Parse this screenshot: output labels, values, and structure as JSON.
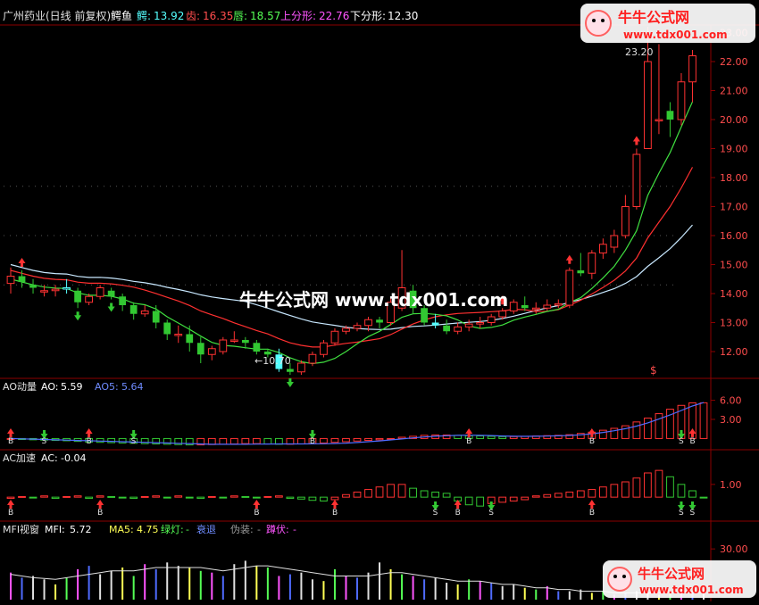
{
  "colors": {
    "background": "#000000",
    "frame": "#8b0000",
    "up": "#ff3232",
    "down": "#32c832",
    "flat_white": "#ffffff",
    "cyan": "#55ffff",
    "ma_white": "#c8e8ff",
    "ma_red": "#ff3030",
    "ma_green": "#40e040",
    "ao5_line": "#4f6bff",
    "ao_text": "#ffffff",
    "label_red": "#ff4d4d",
    "label_green": "#55ff55",
    "label_magenta": "#ff55ff",
    "label_yellow": "#ffff55",
    "label_white": "#e0e0e0",
    "label_blue": "#6f8cff",
    "axis_text": "#ff4d4d"
  },
  "header": {
    "stock": "广州药业(日线 前复权)",
    "alligator": "鳄鱼",
    "jaw_label": "鳄:",
    "jaw_value": "13.92",
    "teeth_label": "齿:",
    "teeth_value": "16.35",
    "lips_label": "唇:",
    "lips_value": "18.57",
    "up_fractal_label": "上分形:",
    "up_fractal_value": "22.76",
    "down_fractal_label": "下分形:",
    "down_fractal_value": "12.30"
  },
  "ao_panel": {
    "name": "AO动量",
    "ao_label": "AO:",
    "ao_value": "5.59",
    "ao5_label": "AO5:",
    "ao5_value": "5.64"
  },
  "ac_panel": {
    "name": "AC加速",
    "ac_label": "AC:",
    "ac_value": "-0.04"
  },
  "mfi_panel": {
    "name": "MFI视窗",
    "mfi_label": "MFI:",
    "mfi_value": "5.72",
    "ma5_label": "MA5:",
    "ma5_value": "4.75",
    "green_light_label": "绿灯:",
    "green_light_value": "-",
    "fade_label": "衰退",
    "fake_label": "伪装:",
    "fake_value": "-",
    "squat_label": "蹲伏:",
    "squat_value": "-"
  },
  "watermark": {
    "brand": "牛牛公式网",
    "url": "www.tdx001.com",
    "center": "牛牛公式网 www.tdx001.com"
  },
  "annotations": {
    "low_label": "←10.70",
    "high_label": "23.20",
    "dollar_mark": "$"
  },
  "chart_data": [
    {
      "type": "candlestick",
      "title": "广州药业(日线 前复权)",
      "ylim": [
        11.2,
        23.2
      ],
      "y_ticks": [
        "12.00",
        "13.00",
        "14.00",
        "15.00",
        "16.00",
        "17.00",
        "18.00",
        "19.00",
        "20.00",
        "21.00",
        "22.00",
        "23.00"
      ],
      "candles": [
        {
          "o": 14.35,
          "h": 14.9,
          "l": 14.0,
          "c": 14.6
        },
        {
          "o": 14.6,
          "h": 14.8,
          "l": 14.2,
          "c": 14.4
        },
        {
          "o": 14.3,
          "h": 14.5,
          "l": 14.0,
          "c": 14.2
        },
        {
          "o": 14.1,
          "h": 14.3,
          "l": 13.9,
          "c": 14.1
        },
        {
          "o": 14.1,
          "h": 14.3,
          "l": 13.9,
          "c": 14.15
        },
        {
          "o": 14.2,
          "h": 14.5,
          "l": 14.0,
          "c": 14.2
        },
        {
          "o": 14.1,
          "h": 14.2,
          "l": 13.5,
          "c": 13.7
        },
        {
          "o": 13.7,
          "h": 14.0,
          "l": 13.6,
          "c": 13.9
        },
        {
          "o": 13.9,
          "h": 14.3,
          "l": 13.8,
          "c": 14.2
        },
        {
          "o": 14.1,
          "h": 14.2,
          "l": 13.8,
          "c": 13.9
        },
        {
          "o": 13.9,
          "h": 14.0,
          "l": 13.4,
          "c": 13.6
        },
        {
          "o": 13.6,
          "h": 13.7,
          "l": 13.1,
          "c": 13.3
        },
        {
          "o": 13.3,
          "h": 13.6,
          "l": 13.2,
          "c": 13.4
        },
        {
          "o": 13.4,
          "h": 13.6,
          "l": 12.8,
          "c": 13.0
        },
        {
          "o": 13.0,
          "h": 13.1,
          "l": 12.4,
          "c": 12.6
        },
        {
          "o": 12.6,
          "h": 12.9,
          "l": 12.3,
          "c": 12.6
        },
        {
          "o": 12.6,
          "h": 12.9,
          "l": 12.0,
          "c": 12.3
        },
        {
          "o": 12.3,
          "h": 12.5,
          "l": 11.6,
          "c": 11.9
        },
        {
          "o": 11.9,
          "h": 12.2,
          "l": 11.7,
          "c": 12.1
        },
        {
          "o": 12.0,
          "h": 12.5,
          "l": 11.9,
          "c": 12.4
        },
        {
          "o": 12.4,
          "h": 12.7,
          "l": 12.3,
          "c": 12.4
        },
        {
          "o": 12.4,
          "h": 12.5,
          "l": 12.1,
          "c": 12.3
        },
        {
          "o": 12.3,
          "h": 12.4,
          "l": 11.9,
          "c": 12.0
        },
        {
          "o": 12.0,
          "h": 12.1,
          "l": 11.8,
          "c": 11.9
        },
        {
          "o": 11.9,
          "h": 12.1,
          "l": 11.3,
          "c": 11.4
        },
        {
          "o": 11.4,
          "h": 11.6,
          "l": 11.2,
          "c": 11.3
        },
        {
          "o": 11.3,
          "h": 11.7,
          "l": 11.2,
          "c": 11.6
        },
        {
          "o": 11.6,
          "h": 12.0,
          "l": 11.5,
          "c": 11.9
        },
        {
          "o": 11.9,
          "h": 12.4,
          "l": 11.8,
          "c": 12.3
        },
        {
          "o": 12.3,
          "h": 12.8,
          "l": 12.2,
          "c": 12.7
        },
        {
          "o": 12.7,
          "h": 12.9,
          "l": 12.6,
          "c": 12.8
        },
        {
          "o": 12.8,
          "h": 13.0,
          "l": 12.7,
          "c": 12.9
        },
        {
          "o": 12.9,
          "h": 13.2,
          "l": 12.7,
          "c": 13.1
        },
        {
          "o": 13.1,
          "h": 13.2,
          "l": 12.8,
          "c": 13.0
        },
        {
          "o": 13.0,
          "h": 13.9,
          "l": 12.9,
          "c": 13.7
        },
        {
          "o": 13.5,
          "h": 15.5,
          "l": 13.4,
          "c": 14.2
        },
        {
          "o": 14.1,
          "h": 14.3,
          "l": 13.3,
          "c": 13.5
        },
        {
          "o": 13.5,
          "h": 13.6,
          "l": 12.9,
          "c": 13.0
        },
        {
          "o": 13.0,
          "h": 13.3,
          "l": 12.8,
          "c": 12.9
        },
        {
          "o": 12.9,
          "h": 13.1,
          "l": 12.6,
          "c": 12.7
        },
        {
          "o": 12.7,
          "h": 13.0,
          "l": 12.6,
          "c": 12.85
        },
        {
          "o": 12.85,
          "h": 13.1,
          "l": 12.7,
          "c": 12.95
        },
        {
          "o": 12.95,
          "h": 13.2,
          "l": 12.8,
          "c": 13.0
        },
        {
          "o": 13.0,
          "h": 13.3,
          "l": 12.9,
          "c": 13.2
        },
        {
          "o": 13.2,
          "h": 13.5,
          "l": 13.1,
          "c": 13.4
        },
        {
          "o": 13.4,
          "h": 13.8,
          "l": 13.3,
          "c": 13.7
        },
        {
          "o": 13.6,
          "h": 13.9,
          "l": 13.4,
          "c": 13.5
        },
        {
          "o": 13.5,
          "h": 13.7,
          "l": 13.3,
          "c": 13.5
        },
        {
          "o": 13.5,
          "h": 13.8,
          "l": 13.4,
          "c": 13.6
        },
        {
          "o": 13.6,
          "h": 13.8,
          "l": 13.5,
          "c": 13.65
        },
        {
          "o": 13.6,
          "h": 14.9,
          "l": 13.5,
          "c": 14.8
        },
        {
          "o": 14.8,
          "h": 15.4,
          "l": 14.6,
          "c": 14.7
        },
        {
          "o": 14.7,
          "h": 15.5,
          "l": 14.5,
          "c": 15.4
        },
        {
          "o": 15.4,
          "h": 15.9,
          "l": 15.2,
          "c": 15.7
        },
        {
          "o": 15.6,
          "h": 16.2,
          "l": 15.4,
          "c": 16.0
        },
        {
          "o": 16.0,
          "h": 17.4,
          "l": 15.9,
          "c": 17.0
        },
        {
          "o": 17.0,
          "h": 19.0,
          "l": 16.9,
          "c": 18.8
        },
        {
          "o": 19.0,
          "h": 23.2,
          "l": 19.8,
          "c": 22.0
        },
        {
          "o": 20.0,
          "h": 22.6,
          "l": 19.5,
          "c": 20.0
        },
        {
          "o": 20.3,
          "h": 20.6,
          "l": 19.4,
          "c": 20.0
        },
        {
          "o": 20.0,
          "h": 21.6,
          "l": 19.8,
          "c": 21.3
        },
        {
          "o": 21.3,
          "h": 22.4,
          "l": 20.6,
          "c": 22.2
        }
      ]
    },
    {
      "type": "bar",
      "title": "AO动量",
      "ylim": [
        -1.2,
        7.2
      ],
      "y_ticks": [
        "3.00",
        "6.00"
      ],
      "series": [
        {
          "name": "AO",
          "values": [
            -0.1,
            -0.15,
            -0.2,
            -0.25,
            -0.3,
            -0.35,
            -0.45,
            -0.55,
            -0.6,
            -0.65,
            -0.7,
            -0.75,
            -0.8,
            -0.85,
            -0.9,
            -0.95,
            -1.0,
            -1.0,
            -0.95,
            -0.9,
            -0.85,
            -0.8,
            -0.8,
            -0.85,
            -0.9,
            -0.9,
            -0.85,
            -0.8,
            -0.7,
            -0.6,
            -0.5,
            -0.4,
            -0.3,
            -0.2,
            0.0,
            0.2,
            0.35,
            0.5,
            0.55,
            0.55,
            0.5,
            0.45,
            0.4,
            0.35,
            0.3,
            0.3,
            0.35,
            0.4,
            0.45,
            0.5,
            0.6,
            0.8,
            1.0,
            1.3,
            1.6,
            2.0,
            2.6,
            3.2,
            3.9,
            4.6,
            5.2,
            5.6,
            5.6
          ]
        },
        {
          "name": "AO5",
          "values": [
            0.0,
            -0.05,
            -0.1,
            -0.15,
            -0.2,
            -0.25,
            -0.3,
            -0.35,
            -0.4,
            -0.45,
            -0.5,
            -0.55,
            -0.6,
            -0.65,
            -0.7,
            -0.75,
            -0.8,
            -0.85,
            -0.9,
            -0.9,
            -0.9,
            -0.9,
            -0.88,
            -0.86,
            -0.85,
            -0.85,
            -0.85,
            -0.84,
            -0.82,
            -0.78,
            -0.72,
            -0.62,
            -0.5,
            -0.38,
            -0.22,
            -0.06,
            0.1,
            0.24,
            0.36,
            0.44,
            0.5,
            0.52,
            0.5,
            0.46,
            0.4,
            0.36,
            0.34,
            0.35,
            0.38,
            0.42,
            0.48,
            0.58,
            0.74,
            0.95,
            1.22,
            1.55,
            1.95,
            2.45,
            3.05,
            3.7,
            4.4,
            5.1,
            5.64
          ]
        }
      ]
    },
    {
      "type": "bar",
      "title": "AC加速",
      "ylim": [
        -1.6,
        2.6
      ],
      "y_ticks": [
        "1.00"
      ],
      "series": [
        {
          "name": "AC",
          "values": [
            -0.1,
            0.05,
            -0.05,
            0.1,
            -0.1,
            0.05,
            0.1,
            -0.1,
            0.1,
            0.05,
            -0.05,
            -0.1,
            0.05,
            0.1,
            -0.05,
            0.1,
            -0.05,
            -0.1,
            0.05,
            -0.05,
            0.1,
            0.05,
            -0.05,
            0.05,
            0.1,
            -0.1,
            -0.15,
            -0.25,
            -0.3,
            -0.2,
            0.2,
            0.4,
            0.6,
            0.8,
            1.0,
            1.0,
            0.7,
            0.5,
            0.4,
            0.3,
            -0.3,
            -0.6,
            -0.7,
            -0.5,
            -0.4,
            -0.3,
            -0.2,
            0.1,
            0.2,
            0.3,
            0.4,
            0.5,
            0.6,
            0.8,
            1.0,
            1.2,
            1.5,
            1.9,
            2.1,
            1.6,
            1.0,
            0.5,
            -0.04
          ]
        }
      ]
    },
    {
      "type": "bar",
      "title": "MFI视窗",
      "ylim": [
        0,
        38
      ],
      "y_ticks": [
        "30.00"
      ],
      "series": [
        {
          "name": "MFI",
          "values": [
            16,
            13,
            14,
            12,
            9,
            13,
            18,
            20,
            15,
            17,
            19,
            14,
            21,
            18,
            22,
            20,
            19,
            17,
            16,
            14,
            21,
            23,
            20,
            19,
            14,
            15,
            16,
            12,
            11,
            18,
            14,
            13,
            16,
            22,
            18,
            15,
            14,
            12,
            13,
            10,
            9,
            12,
            11,
            10,
            8,
            9,
            7,
            6,
            8,
            5,
            5,
            6,
            4,
            5,
            3,
            4,
            5,
            4,
            3,
            5,
            6,
            5,
            5.72
          ]
        },
        {
          "name": "MA5",
          "values": [
            15,
            14,
            13,
            12.5,
            12,
            13,
            14,
            15,
            16,
            17,
            17,
            17,
            18,
            19,
            19,
            19,
            19,
            19,
            18,
            17,
            18,
            19,
            20,
            20,
            19,
            18,
            17,
            16,
            15,
            14,
            14,
            14,
            14,
            15,
            16,
            16,
            15,
            14,
            13,
            12,
            11,
            11,
            11,
            10,
            9,
            9,
            8,
            7,
            7,
            6,
            6,
            5,
            5,
            5,
            4,
            4,
            4,
            4,
            4,
            4.5,
            4.7,
            4.7,
            4.75
          ]
        }
      ]
    }
  ]
}
